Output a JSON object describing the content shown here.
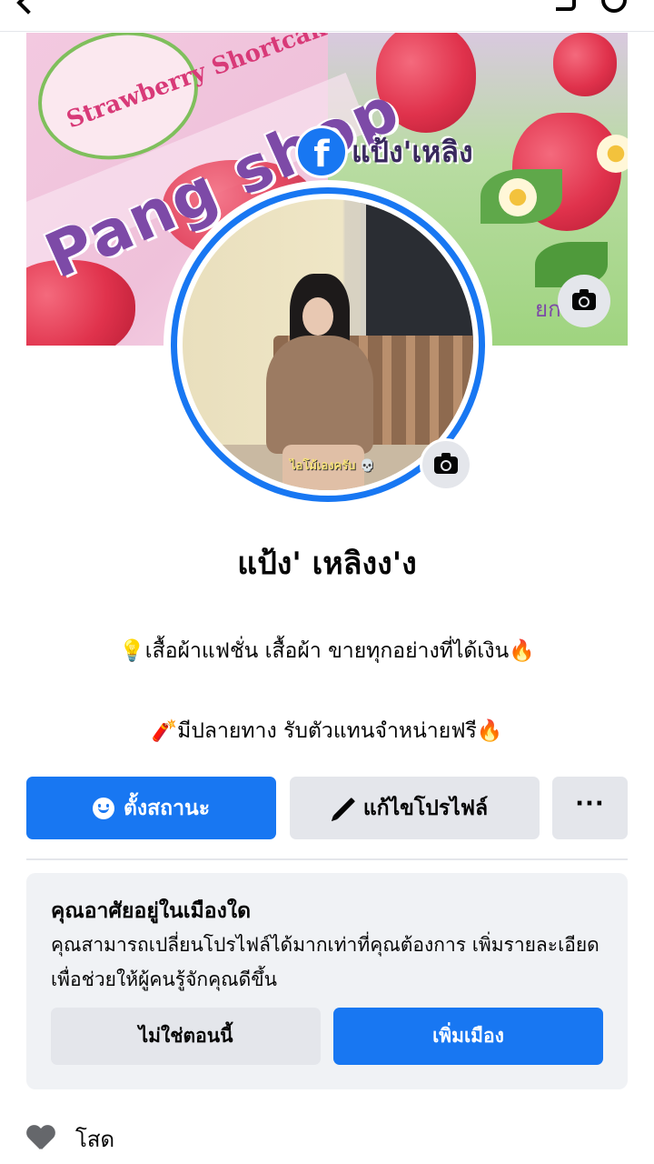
{
  "top_bar": {
    "title_partial": "แป้ง' เหลิงง'ง"
  },
  "cover": {
    "brand_logo_text": "Strawberry Shortcake",
    "shop_title": "Pang shop",
    "facebook_name": "แป้ง'เหลิง",
    "partial_tag": "ยกาญ",
    "camera_icon": "camera-icon"
  },
  "avatar": {
    "caption": "ไอโม้เองครับ 💀",
    "camera_icon": "camera-icon",
    "ring_color": "#1877f2"
  },
  "profile": {
    "name": "แป้ง' เหลิงง'ง",
    "bio_line1": "💡เสื้อผ้าแฟชั่น เสื้อผ้า ขายทุกอย่างที่ได้เงิน🔥",
    "bio_line2": "🧨มีปลายทาง รับตัวแทนจำหน่ายฟรี🔥"
  },
  "actions": {
    "status_label": "ตั้งสถานะ",
    "edit_label": "แก้ไขโปรไฟล์",
    "more_label": "···",
    "accent": "#1877f2"
  },
  "city_prompt": {
    "title": "คุณอาศัยอยู่ในเมืองใด",
    "description": "คุณสามารถเปลี่ยนโปรไฟล์ได้มากเท่าที่คุณต้องการ เพิ่มรายละเอียดเพื่อช่วยให้ผู้คนรู้จักคุณดีขึ้น",
    "not_now_label": "ไม่ใช่ตอนนี้",
    "add_city_label": "เพิ่มเมือง"
  },
  "details": {
    "relationship_icon": "heart-icon",
    "relationship_status": "โสด"
  }
}
